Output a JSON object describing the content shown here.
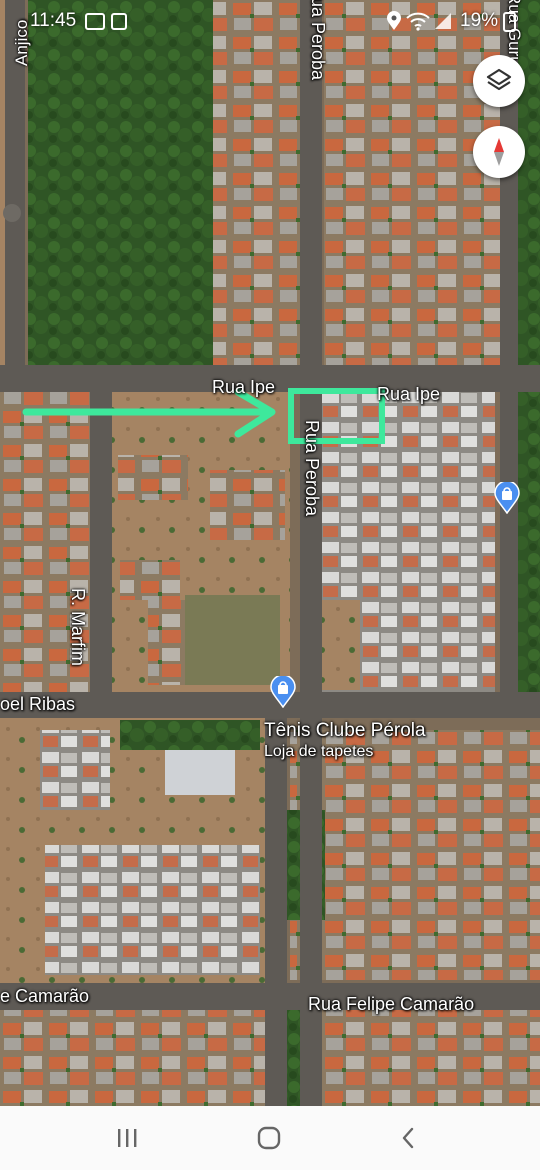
{
  "status_bar": {
    "time": "11:45",
    "battery": "19%",
    "icons": [
      "sim-icon",
      "media-icon",
      "location-icon",
      "wifi-icon",
      "signal-icon",
      "battery-icon"
    ]
  },
  "map": {
    "type": "satellite",
    "street_labels": {
      "anjico": "Anjico",
      "rua_peroba_top": "Rua Peroba",
      "rua_guru": "Rua Guru",
      "rua_ipe_left": "Rua Ipe",
      "rua_ipe_right": "Rua Ipe",
      "rua_peroba_mid": "Rua Peroba",
      "r_marfim": "R. Marfim",
      "manoel_ribas": "oel Ribas",
      "camarao_left": "e Camarão",
      "rua_felipe_camarao": "Rua Felipe Camarão"
    },
    "poi": {
      "name": "Tênis Clube Pérola",
      "category": "Loja de tapetes",
      "icon": "shopping-bag-pin-icon"
    },
    "poi_right": {
      "icon": "shopping-bag-pin-icon"
    },
    "annotation": {
      "arrow_color": "#3ee89c",
      "box_color": "#3ee89c"
    },
    "controls": {
      "layers_icon": "layers-icon",
      "compass_icon": "compass-icon"
    }
  },
  "navbar": {
    "recents_icon": "recents-icon",
    "home_icon": "home-icon",
    "back_icon": "back-icon"
  }
}
